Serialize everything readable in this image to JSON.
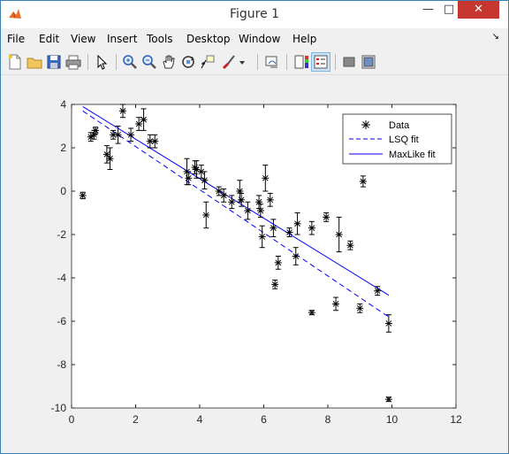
{
  "window": {
    "title": "Figure 1"
  },
  "menu": [
    "File",
    "Edit",
    "View",
    "Insert",
    "Tools",
    "Desktop",
    "Window",
    "Help"
  ],
  "toolbar": [
    "new-figure",
    "open-file",
    "save",
    "print",
    "edit-plot",
    "zoom-in",
    "zoom-out",
    "pan",
    "rotate-3d",
    "data-cursor",
    "brush",
    "link-plot",
    "colorbar",
    "legend",
    "hide-plot-tools",
    "show-plot-tools"
  ],
  "chart_data": {
    "type": "scatter",
    "title": "",
    "xlabel": "",
    "ylabel": "",
    "xlim": [
      0,
      12
    ],
    "ylim": [
      -10,
      4
    ],
    "xticks": [
      0,
      2,
      4,
      6,
      8,
      10,
      12
    ],
    "yticks": [
      -10,
      -8,
      -6,
      -4,
      -2,
      0,
      2,
      4
    ],
    "grid": false,
    "legend_position": "top-right",
    "legend": [
      "Data",
      "LSQ fit",
      "MaxLike fit"
    ],
    "series": [
      {
        "name": "Data",
        "kind": "errorbar",
        "points": [
          {
            "x": 0.35,
            "y": -0.2,
            "err": 0.15
          },
          {
            "x": 0.6,
            "y": 2.5,
            "err": 0.2
          },
          {
            "x": 0.7,
            "y": 2.6,
            "err": 0.2
          },
          {
            "x": 0.75,
            "y": 2.8,
            "err": 0.15
          },
          {
            "x": 1.1,
            "y": 1.7,
            "err": 0.4
          },
          {
            "x": 1.2,
            "y": 1.5,
            "err": 0.5
          },
          {
            "x": 1.3,
            "y": 2.6,
            "err": 0.2
          },
          {
            "x": 1.45,
            "y": 2.6,
            "err": 0.4
          },
          {
            "x": 1.6,
            "y": 3.7,
            "err": 0.3
          },
          {
            "x": 1.85,
            "y": 2.6,
            "err": 0.3
          },
          {
            "x": 2.1,
            "y": 3.1,
            "err": 0.3
          },
          {
            "x": 2.25,
            "y": 3.3,
            "err": 0.5
          },
          {
            "x": 2.45,
            "y": 2.3,
            "err": 0.3
          },
          {
            "x": 2.6,
            "y": 2.3,
            "err": 0.3
          },
          {
            "x": 3.6,
            "y": 0.9,
            "err": 0.6
          },
          {
            "x": 3.65,
            "y": 0.6,
            "err": 0.3
          },
          {
            "x": 3.85,
            "y": 1.1,
            "err": 0.3
          },
          {
            "x": 3.9,
            "y": 1.0,
            "err": 0.4
          },
          {
            "x": 4.05,
            "y": 0.9,
            "err": 0.3
          },
          {
            "x": 4.15,
            "y": 0.5,
            "err": 0.4
          },
          {
            "x": 4.2,
            "y": -1.1,
            "err": 0.6
          },
          {
            "x": 4.6,
            "y": 0.0,
            "err": 0.2
          },
          {
            "x": 4.75,
            "y": -0.2,
            "err": 0.3
          },
          {
            "x": 5.0,
            "y": -0.5,
            "err": 0.3
          },
          {
            "x": 5.25,
            "y": 0.0,
            "err": 0.5
          },
          {
            "x": 5.3,
            "y": -0.4,
            "err": 0.3
          },
          {
            "x": 5.5,
            "y": -0.9,
            "err": 0.4
          },
          {
            "x": 5.85,
            "y": -0.5,
            "err": 0.3
          },
          {
            "x": 5.9,
            "y": -0.9,
            "err": 0.3
          },
          {
            "x": 5.95,
            "y": -2.1,
            "err": 0.5
          },
          {
            "x": 6.05,
            "y": 0.6,
            "err": 0.6
          },
          {
            "x": 6.2,
            "y": -0.4,
            "err": 0.3
          },
          {
            "x": 6.3,
            "y": -1.7,
            "err": 0.4
          },
          {
            "x": 6.35,
            "y": -4.3,
            "err": 0.2
          },
          {
            "x": 6.45,
            "y": -3.3,
            "err": 0.3
          },
          {
            "x": 6.8,
            "y": -1.9,
            "err": 0.2
          },
          {
            "x": 7.0,
            "y": -3.0,
            "err": 0.4
          },
          {
            "x": 7.05,
            "y": -1.5,
            "err": 0.5
          },
          {
            "x": 7.5,
            "y": -1.7,
            "err": 0.3
          },
          {
            "x": 7.5,
            "y": -5.6,
            "err": 0.1
          },
          {
            "x": 7.95,
            "y": -1.2,
            "err": 0.2
          },
          {
            "x": 8.25,
            "y": -5.2,
            "err": 0.3
          },
          {
            "x": 8.35,
            "y": -2.0,
            "err": 0.8
          },
          {
            "x": 8.7,
            "y": -2.5,
            "err": 0.2
          },
          {
            "x": 9.0,
            "y": -5.4,
            "err": 0.2
          },
          {
            "x": 9.1,
            "y": 0.45,
            "err": 0.25
          },
          {
            "x": 9.55,
            "y": -4.6,
            "err": 0.2
          },
          {
            "x": 9.9,
            "y": -6.1,
            "err": 0.4
          },
          {
            "x": 9.9,
            "y": -9.6,
            "err": 0.1
          }
        ]
      },
      {
        "name": "LSQ fit",
        "kind": "dashed-line",
        "x": [
          0.35,
          9.9
        ],
        "y": [
          3.7,
          -5.8
        ]
      },
      {
        "name": "MaxLike fit",
        "kind": "solid-line",
        "x": [
          0.35,
          9.9
        ],
        "y": [
          3.9,
          -4.8
        ]
      }
    ],
    "colors": {
      "data": "#000000",
      "fits": "#0000ff"
    }
  }
}
